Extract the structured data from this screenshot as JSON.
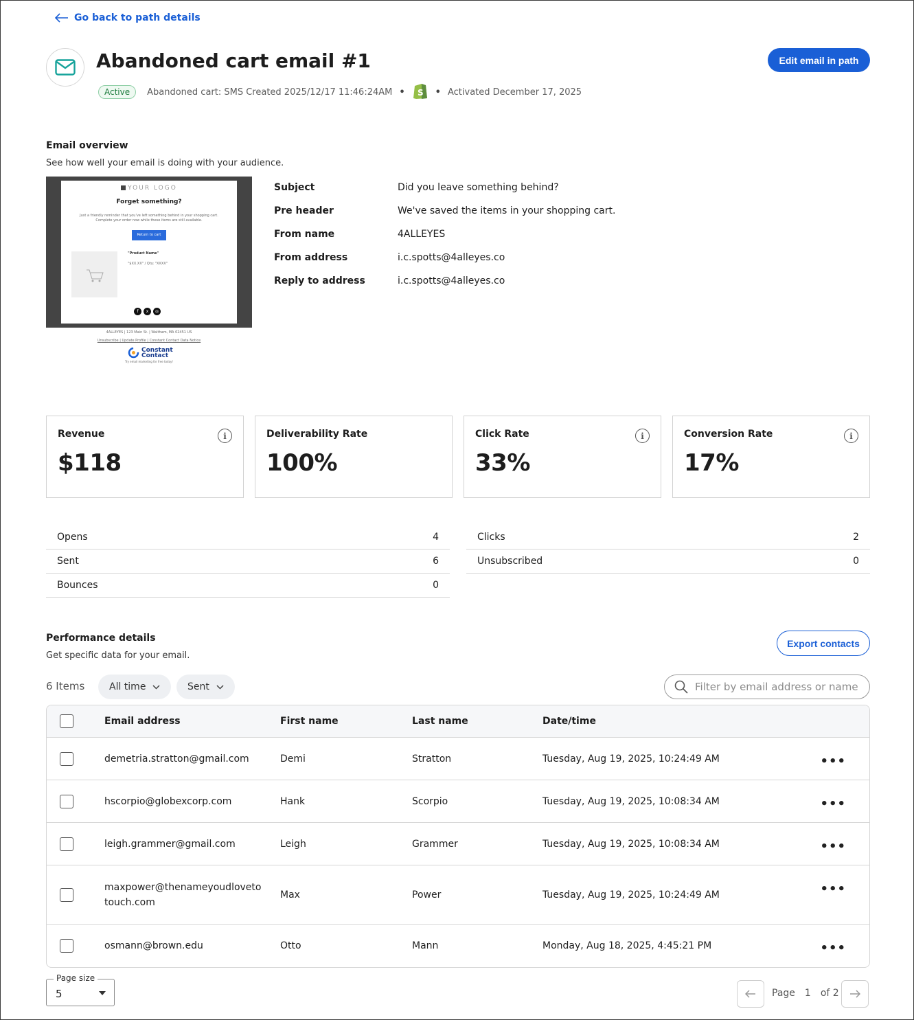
{
  "nav": {
    "back_label": "Go back to path details"
  },
  "header": {
    "title": "Abandoned cart email #1",
    "status": "Active",
    "source": "Abandoned cart: SMS Created 2025/12/17 11:46:24AM",
    "activated": "Activated December 17, 2025",
    "edit_button": "Edit email in path",
    "icons": {
      "email": "envelope-icon",
      "store": "shopify-icon"
    },
    "colors": {
      "accent": "#1a5fd6",
      "icon_teal": "#17a39b",
      "status_green": "#1b7a3c"
    }
  },
  "overview": {
    "title": "Email overview",
    "subtitle": "See how well your email is doing with your audience.",
    "preview": {
      "logo": "YOUR LOGO",
      "heading": "Forget something?",
      "body": "Just a friendly reminder that you've left something behind in your shopping cart. Complete your order now while these items are still available.",
      "cta": "Return to cart",
      "product_name": "\"Product Name\"",
      "product_price": "\"$XX.XX\" / Qty: \"XXXX\"",
      "address": "4ALLEYES | 123 Main St. | Waltham, MA 02451 US",
      "links": "Unsubscribe | Update Profile | Constant Contact Data Notice",
      "brand": "Constant Contact",
      "brand_tag": "Try email marketing for free today!"
    },
    "fields": [
      {
        "label": "Subject",
        "value": "Did you leave something behind?"
      },
      {
        "label": "Pre header",
        "value": "We've saved the items in your shopping cart."
      },
      {
        "label": "From name",
        "value": "4ALLEYES"
      },
      {
        "label": "From address",
        "value": "i.c.spotts@4alleyes.co"
      },
      {
        "label": "Reply to address",
        "value": "i.c.spotts@4alleyes.co"
      }
    ]
  },
  "stats": [
    {
      "label": "Revenue",
      "value": "$118",
      "info": true
    },
    {
      "label": "Deliverability Rate",
      "value": "100%",
      "info": false
    },
    {
      "label": "Click Rate",
      "value": "33%",
      "info": true
    },
    {
      "label": "Conversion Rate",
      "value": "17%",
      "info": true
    }
  ],
  "metrics_left": [
    {
      "label": "Opens",
      "value": "4"
    },
    {
      "label": "Sent",
      "value": "6"
    },
    {
      "label": "Bounces",
      "value": "0"
    }
  ],
  "metrics_right": [
    {
      "label": "Clicks",
      "value": "2"
    },
    {
      "label": "Unsubscribed",
      "value": "0"
    }
  ],
  "performance": {
    "title": "Performance details",
    "subtitle": "Get specific data for your email.",
    "export_button": "Export contacts",
    "items_count": "6 Items",
    "filter_time": "All time",
    "filter_status": "Sent",
    "search_placeholder": "Filter by email address or name",
    "columns": [
      "Email address",
      "First name",
      "Last name",
      "Date/time"
    ],
    "rows": [
      {
        "email": "demetria.stratton@gmail.com",
        "first": "Demi",
        "last": "Stratton",
        "date": "Tuesday, Aug 19, 2025, 10:24:49 AM"
      },
      {
        "email": "hscorpio@globexcorp.com",
        "first": "Hank",
        "last": "Scorpio",
        "date": "Tuesday, Aug 19, 2025, 10:08:34 AM"
      },
      {
        "email": "leigh.grammer@gmail.com",
        "first": "Leigh",
        "last": "Grammer",
        "date": "Tuesday, Aug 19, 2025, 10:08:34 AM"
      },
      {
        "email": "maxpower@thenameyoudloveto touch.com",
        "first": "Max",
        "last": "Power",
        "date": "Tuesday, Aug 19, 2025, 10:24:49 AM"
      },
      {
        "email": "osmann@brown.edu",
        "first": "Otto",
        "last": "Mann",
        "date": "Monday, Aug 18, 2025, 4:45:21 PM"
      }
    ],
    "row_menu": "•••"
  },
  "pagination": {
    "page_size_label": "Page size",
    "page_size": "5",
    "page_word": "Page",
    "current_page": "1",
    "of_pages": "of 2"
  }
}
